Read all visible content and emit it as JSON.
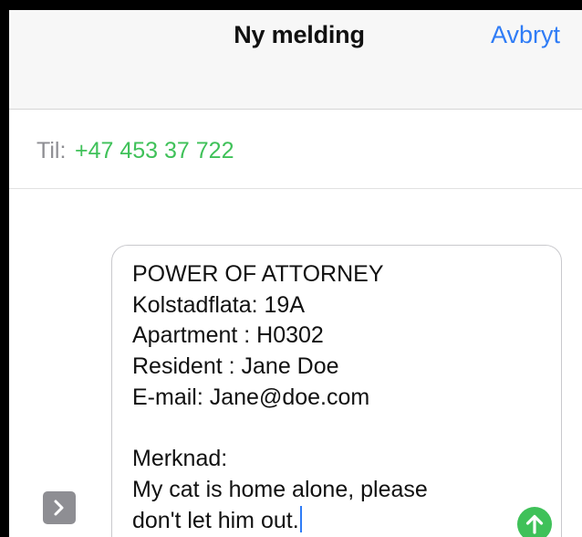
{
  "header": {
    "title": "Ny melding",
    "cancel_label": "Avbryt"
  },
  "recipient": {
    "label": "Til:",
    "number": "+47 453 37 722"
  },
  "message": {
    "lines": [
      "POWER OF ATTORNEY",
      "Kolstadflata: 19A",
      "Apartment : H0302",
      "Resident : Jane Doe",
      "E-mail: Jane@doe.com",
      "",
      "Merknad:",
      "My cat is home alone, please",
      "don't let him out."
    ]
  },
  "icons": {
    "expand": "chevron-right-icon",
    "send": "arrow-up-icon"
  },
  "colors": {
    "accent_blue": "#2f7cf6",
    "accent_green": "#3fc159",
    "secondary_gray": "#8e8e93"
  }
}
